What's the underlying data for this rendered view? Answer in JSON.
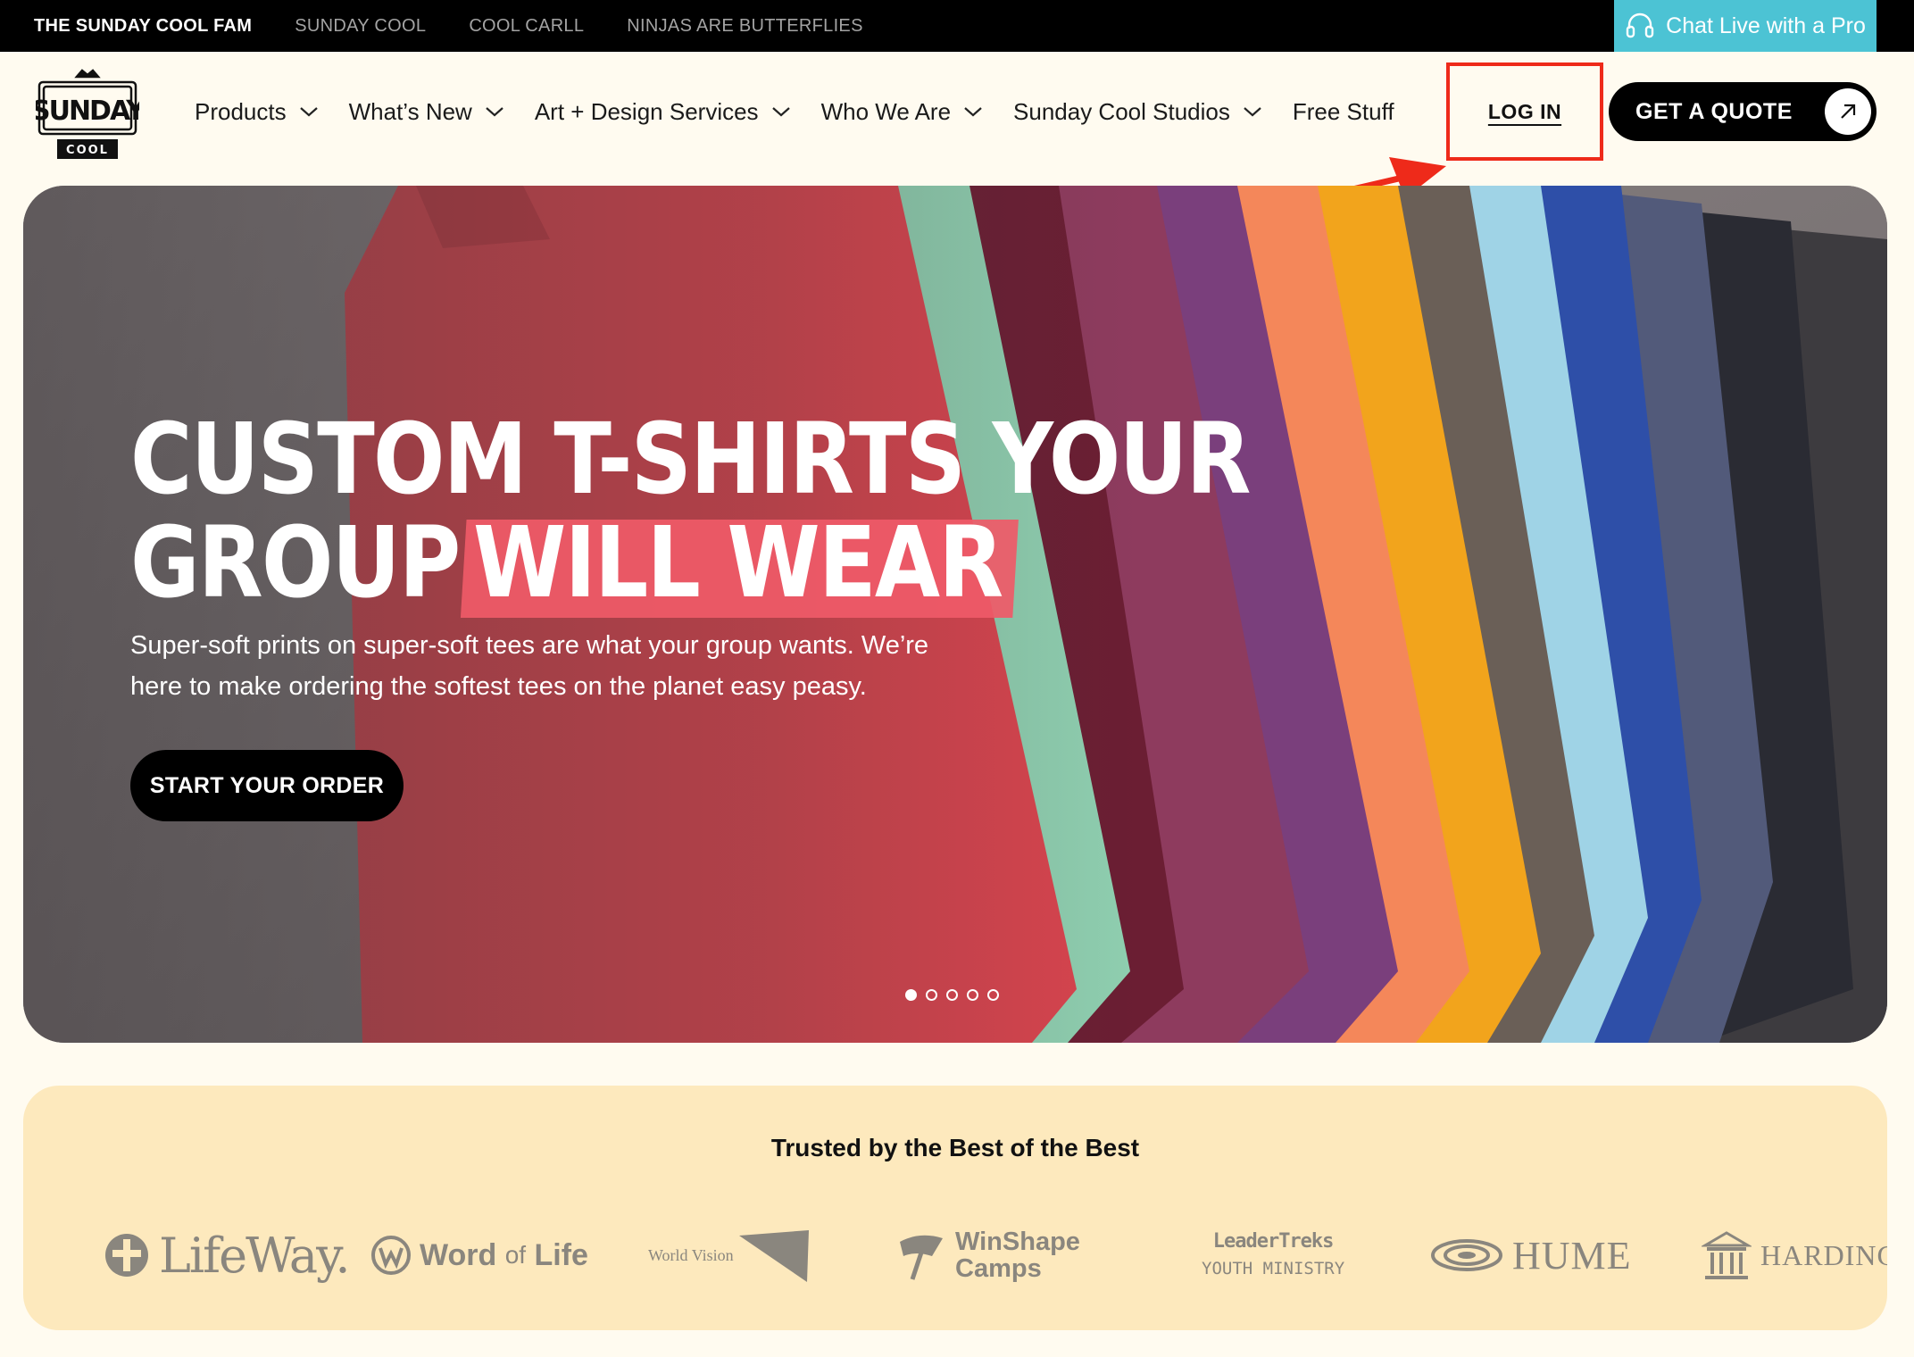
{
  "topbar": {
    "links": [
      "THE SUNDAY COOL FAM",
      "SUNDAY COOL",
      "COOL CARLL",
      "NINJAS ARE BUTTERFLIES"
    ],
    "chat_label": "Chat Live with a Pro",
    "chat_icon": "headset-icon",
    "chat_color": "#4cc3d4"
  },
  "logo": {
    "top": "SUNDAY",
    "bottom": "COOL"
  },
  "nav": {
    "items": [
      "Products",
      "What’s New",
      "Art + Design Services",
      "Who We Are",
      "Sunday Cool Studios",
      "Free Stuff"
    ],
    "login_label": "LOG IN",
    "quote_label": "GET A QUOTE",
    "annotation_color": "#ee2a1a"
  },
  "hero": {
    "title_line1": "CUSTOM T-SHIRTS YOUR",
    "title_line2_plain": "GROUP",
    "title_line2_highlight": "WILL WEAR",
    "subtitle": "Super-soft prints on super-soft tees are what your group wants. We’re here to make ordering the softest tees on the planet easy peasy.",
    "cta_label": "START YOUR ORDER",
    "slide_count": 5,
    "active_slide": 1,
    "highlight_color": "#ef5a68"
  },
  "trusted": {
    "title": "Trusted by the Best of the Best",
    "brands": {
      "lifeway": "LifeWay.",
      "word": "Word",
      "of": "of",
      "life": "Life",
      "worldvision": "World Vision",
      "winshape1": "WinShape",
      "winshape2": "Camps",
      "leader1": "LeaderTreks",
      "leader2": "YOUTH MINISTRY",
      "hume": "HUME",
      "harding": "HARDING"
    },
    "bg_color": "#fde9bd"
  }
}
